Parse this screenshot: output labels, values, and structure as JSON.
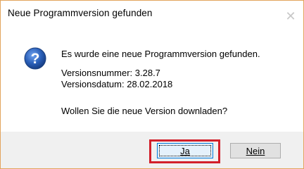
{
  "dialog": {
    "title": "Neue Programmversion gefunden",
    "close_glyph": "✕",
    "icon": "question-icon",
    "message": "Es wurde eine neue Programmversion gefunden.",
    "version_number": "Versionsnummer: 3.28.7",
    "version_date": "Versionsdatum: 28.02.2018",
    "question": "Wollen Sie die neue Version downladen?"
  },
  "buttons": {
    "yes_label": "Ja",
    "no_label": "Nein"
  },
  "colors": {
    "window_border": "#e3a45d",
    "highlight": "#d21f2a",
    "icon_blue": "#2a5fb8",
    "footer_bg": "#f0f0f0"
  }
}
